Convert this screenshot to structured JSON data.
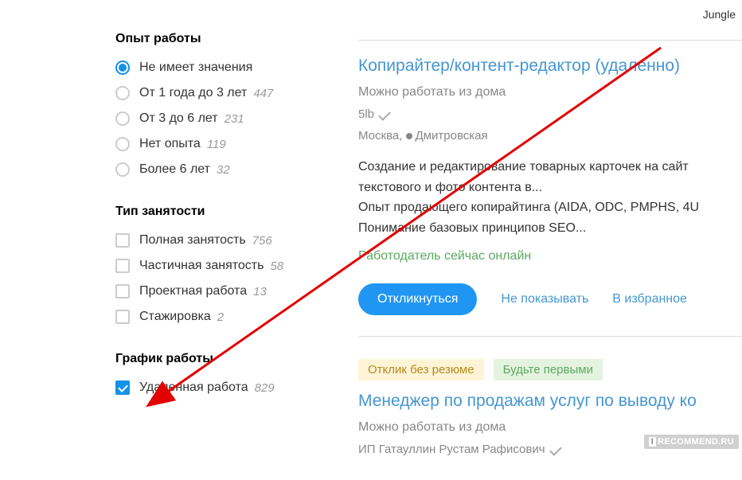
{
  "top_right": "Jungle",
  "filters": {
    "experience": {
      "title": "Опыт работы",
      "options": [
        {
          "label": "Не имеет значения",
          "count": "",
          "selected": true
        },
        {
          "label": "От 1 года до 3 лет",
          "count": "447",
          "selected": false
        },
        {
          "label": "От 3 до 6 лет",
          "count": "231",
          "selected": false
        },
        {
          "label": "Нет опыта",
          "count": "119",
          "selected": false
        },
        {
          "label": "Более 6 лет",
          "count": "32",
          "selected": false
        }
      ]
    },
    "employment": {
      "title": "Тип занятости",
      "options": [
        {
          "label": "Полная занятость",
          "count": "756",
          "selected": false
        },
        {
          "label": "Частичная занятость",
          "count": "58",
          "selected": false
        },
        {
          "label": "Проектная работа",
          "count": "13",
          "selected": false
        },
        {
          "label": "Стажировка",
          "count": "2",
          "selected": false
        }
      ]
    },
    "schedule": {
      "title": "График работы",
      "options": [
        {
          "label": "Удаленная работа",
          "count": "829",
          "selected": true
        }
      ]
    }
  },
  "job1": {
    "title": "Копирайтер/контент-редактор (удаленно)",
    "subtitle": "Можно работать из дома",
    "company": "5lb",
    "city": "Москва,",
    "metro": "Дмитровская",
    "description_line1": "Создание и редактирование товарных карточек на сайт",
    "description_line2": "текстового и фото контента в...",
    "description_line3": "Опыт продающего копирайтинга (AIDA, ODC, PMPHS, 4U",
    "description_line4": "Понимание базовых принципов SEO...",
    "online": "Работодатель сейчас онлайн",
    "apply": "Откликнуться",
    "hide": "Не показывать",
    "favorite": "В избранное"
  },
  "job2": {
    "badge1": "Отклик без резюме",
    "badge2": "Будьте первыми",
    "title": "Менеджер по продажам услуг по выводу ко",
    "subtitle": "Можно работать из дома",
    "company": "ИП Гатауллин Рустам Рафисович"
  },
  "watermark": "RECOMMEND.RU"
}
